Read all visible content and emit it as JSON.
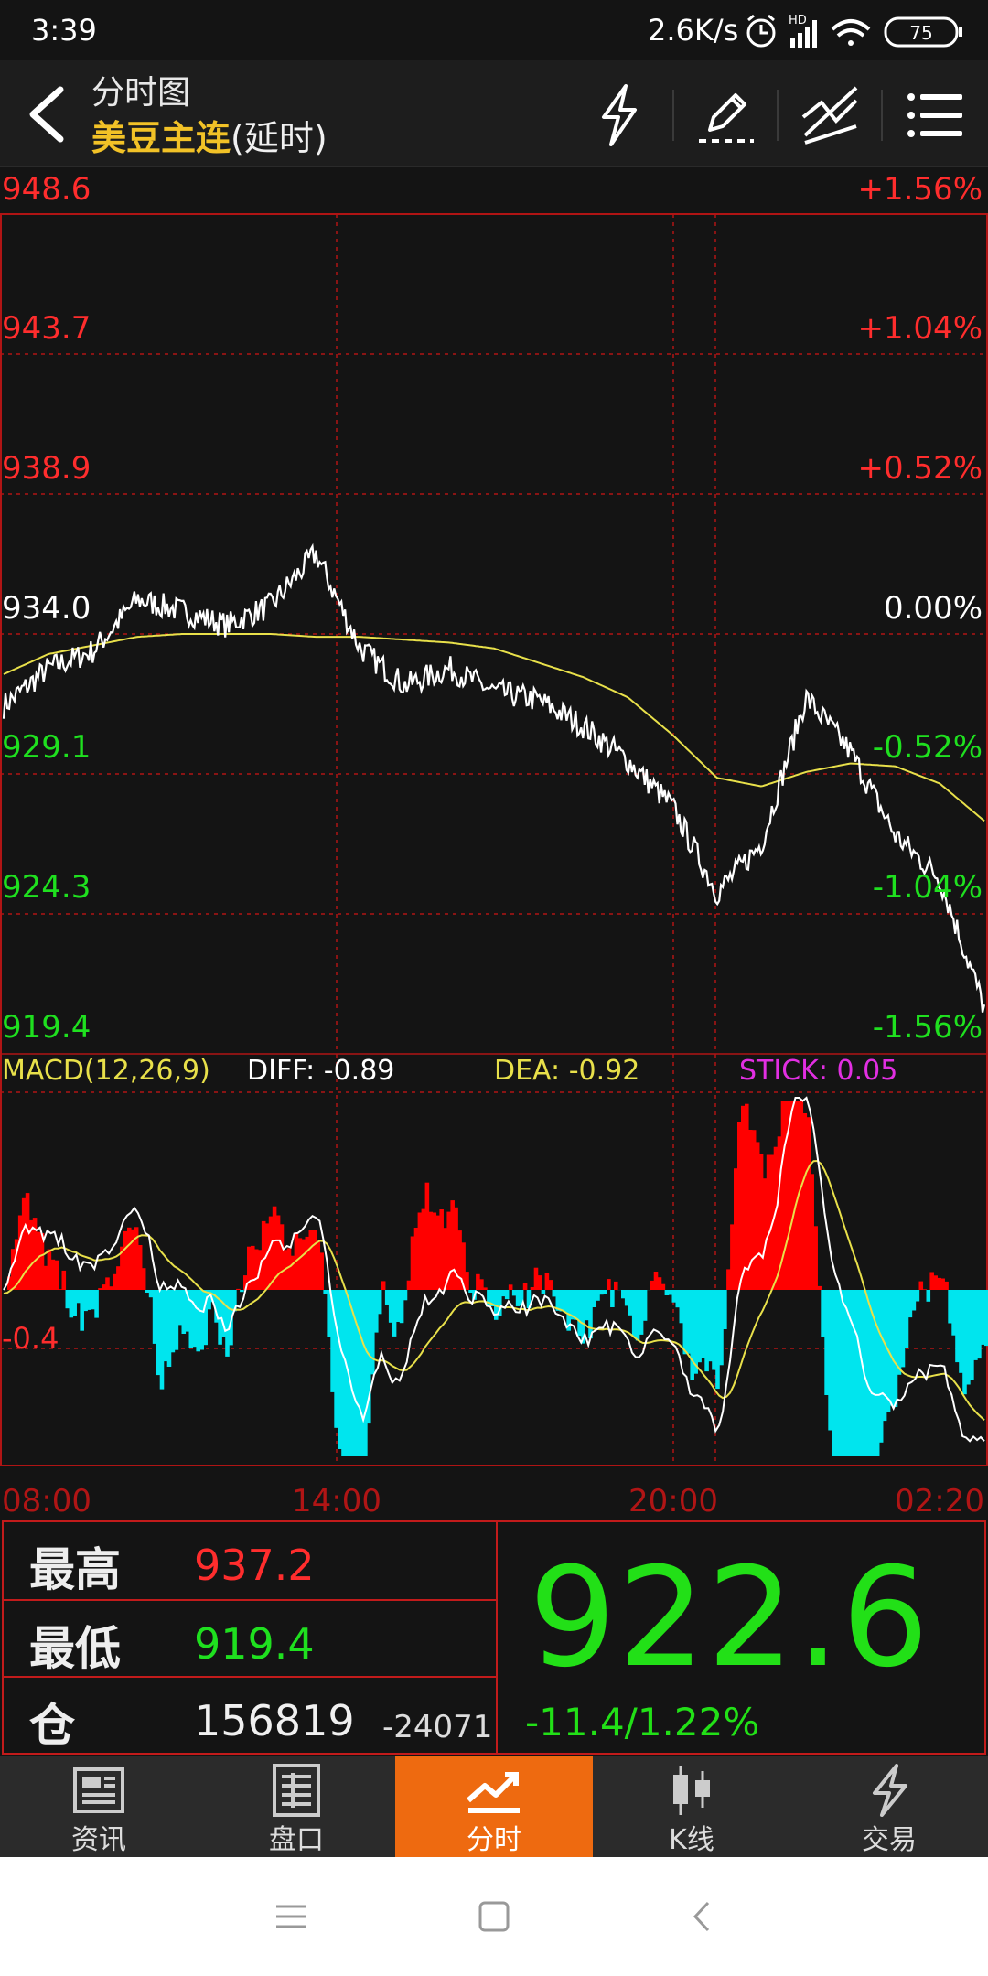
{
  "status_bar": {
    "time": "3:39",
    "net_speed": "2.6K/s",
    "hd_label": "HD",
    "battery": "75"
  },
  "header": {
    "title": "分时图",
    "subtitle_main": "美豆主连",
    "subtitle_suffix": "(延时)",
    "icons": [
      "lightning-icon",
      "pencil-icon",
      "draw-line-icon",
      "menu-icon"
    ]
  },
  "chart": {
    "left_labels": [
      "948.6",
      "943.7",
      "938.9",
      "934.0",
      "929.1",
      "924.3",
      "919.4"
    ],
    "right_labels": [
      "+1.56%",
      "+1.04%",
      "+0.52%",
      "0.00%",
      "-0.52%",
      "-1.04%",
      "-1.56%"
    ],
    "time_labels": [
      "08:00",
      "14:00",
      "20:00",
      "02:20"
    ],
    "macd": {
      "title": "MACD(12,26,9)",
      "diff": "DIFF: -0.89",
      "dea": "DEA: -0.92",
      "stick": "STICK: 0.05",
      "axis_label": "-0.4"
    },
    "colors": {
      "up": "#ff2d2d",
      "down": "#1fe01f",
      "price": "#ffffff",
      "avg": "#e8e04a",
      "stick_up": "#ff0000",
      "stick_down": "#00e5ee",
      "stick_label": "#e22fe2",
      "grid": "#b01515"
    }
  },
  "chart_data": {
    "type": "line",
    "x": [
      "08:00",
      "14:00",
      "20:00",
      "02:20"
    ],
    "ylim": [
      919.4,
      948.6
    ],
    "series": [
      {
        "values": [
          931.5,
          932.8,
          933.4,
          935.2,
          934.8,
          934.3,
          935.0,
          936.8,
          933.5,
          932.2,
          932.8,
          932.0,
          931.7,
          930.8,
          929.6,
          928.0,
          925.0,
          926.7,
          931.8,
          929.9,
          927.0,
          925.5,
          921.0
        ]
      },
      {
        "values": [
          932.6,
          933.3,
          933.6,
          933.9,
          934.0,
          934.0,
          934.0,
          933.9,
          933.9,
          933.8,
          933.7,
          933.5,
          933.0,
          932.5,
          931.8,
          930.5,
          929.0,
          928.7,
          929.2,
          929.5,
          929.4,
          928.8,
          927.5
        ]
      }
    ],
    "macd": {
      "diff": -0.89,
      "dea": -0.92,
      "stick": 0.05
    }
  },
  "info": {
    "high_label": "最高",
    "high_value": "937.2",
    "low_label": "最低",
    "low_value": "919.4",
    "oi_label": "仓",
    "oi_value": "156819",
    "oi_change": "-24071",
    "price": "922.6",
    "change": "-11.4/1.22%"
  },
  "tabs": [
    {
      "label": "资讯",
      "icon": "news-icon"
    },
    {
      "label": "盘口",
      "icon": "orderbook-icon"
    },
    {
      "label": "分时",
      "icon": "intraday-icon"
    },
    {
      "label": "K线",
      "icon": "candlestick-icon"
    },
    {
      "label": "交易",
      "icon": "trade-icon"
    }
  ],
  "nav": [
    "menu-nav-icon",
    "home-nav-icon",
    "back-nav-icon"
  ]
}
